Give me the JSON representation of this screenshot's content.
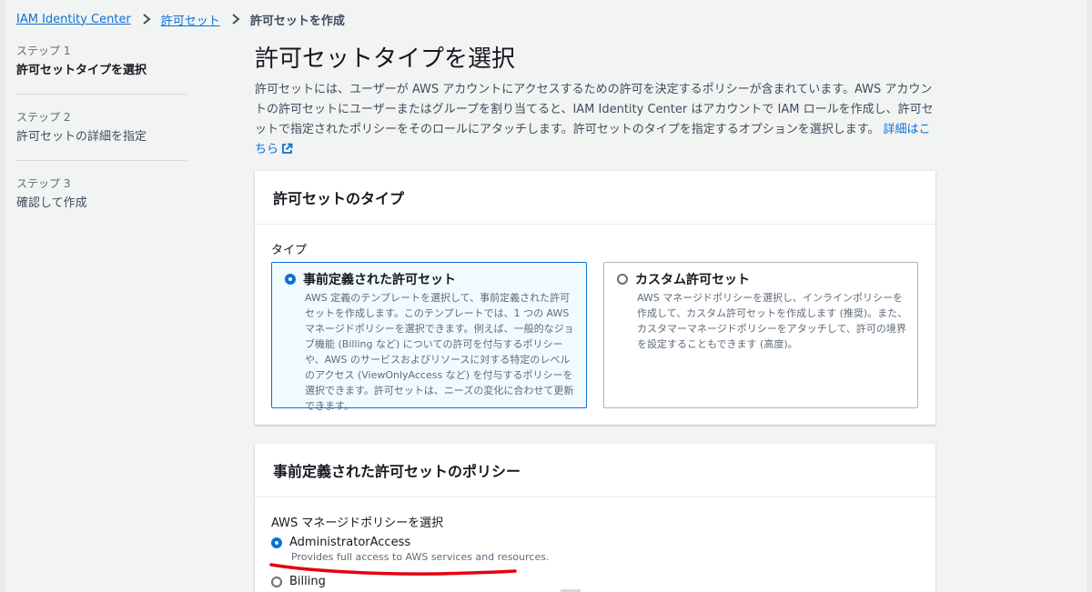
{
  "breadcrumb": {
    "items": [
      "IAM Identity Center",
      "許可セット"
    ],
    "current": "許可セットを作成"
  },
  "steps": [
    {
      "number": "ステップ 1",
      "title": "許可セットタイプを選択",
      "active": true
    },
    {
      "number": "ステップ 2",
      "title": "許可セットの詳細を指定",
      "active": false
    },
    {
      "number": "ステップ 3",
      "title": "確認して作成",
      "active": false
    }
  ],
  "main": {
    "title": "許可セットタイプを選択",
    "description": "許可セットには、ユーザーが AWS アカウントにアクセスするための許可を決定するポリシーが含まれています。AWS アカウントの許可セットにユーザーまたはグループを割り当てると、IAM Identity Center はアカウントで IAM ロールを作成し、許可セットで指定されたポリシーをそのロールにアタッチします。許可セットのタイプを指定するオプションを選択します。",
    "learn_more": "詳細はこちら"
  },
  "type_panel": {
    "heading": "許可セットのタイプ",
    "field_label": "タイプ",
    "options": [
      {
        "title": "事前定義された許可セット",
        "description": "AWS 定義のテンプレートを選択して、事前定義された許可セットを作成します。このテンプレートでは、1 つの AWS マネージドポリシーを選択できます。例えば、一般的なジョブ機能 (Billing など) についての許可を付与するポリシーや、AWS のサービスおよびリソースに対する特定のレベルのアクセス (ViewOnlyAccess など) を付与するポリシーを選択できます。許可セットは、ニーズの変化に合わせて更新できます。",
        "selected": true
      },
      {
        "title": "カスタム許可セット",
        "description": "AWS マネージドポリシーを選択し、インラインポリシーを作成して、カスタム許可セットを作成します (推奨)。また、カスタマーマネージドポリシーをアタッチして、許可の境界を設定することもできます (高度)。",
        "selected": false
      }
    ]
  },
  "policy_panel": {
    "heading": "事前定義された許可セットのポリシー",
    "field_label": "AWS マネージドポリシーを選択",
    "options": [
      {
        "name": "AdministratorAccess",
        "description": "Provides full access to AWS services and resources.",
        "selected": true
      },
      {
        "name": "Billing",
        "description": "",
        "selected": false
      }
    ]
  },
  "colors": {
    "link": "#0972d3",
    "selected_border": "#0972d3",
    "selected_bg": "#f1faff",
    "annotation_red": "#e3000f"
  }
}
